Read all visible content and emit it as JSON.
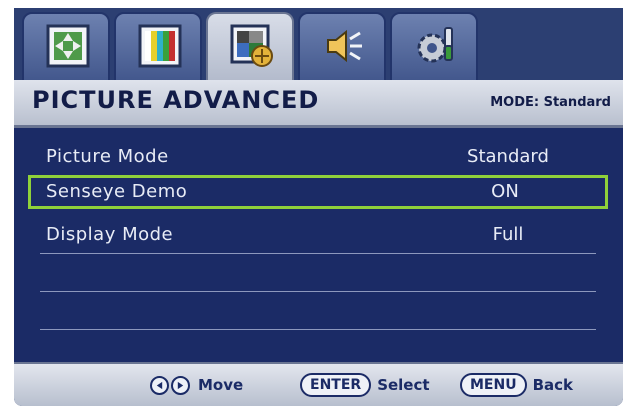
{
  "tabs": [
    {
      "icon": "picture-adjust-icon",
      "active": false
    },
    {
      "icon": "color-bars-icon",
      "active": false
    },
    {
      "icon": "picture-advanced-icon",
      "active": true
    },
    {
      "icon": "speaker-icon",
      "active": false
    },
    {
      "icon": "system-settings-icon",
      "active": false
    }
  ],
  "header": {
    "title": "PICTURE ADVANCED",
    "mode": "MODE: Standard"
  },
  "rows": [
    {
      "label": "Picture Mode",
      "value": "Standard",
      "selected": false
    },
    {
      "label": "Senseye Demo",
      "value": "ON",
      "selected": true
    },
    {
      "label": "Display Mode",
      "value": "Full",
      "selected": false
    },
    {
      "label": "",
      "value": "",
      "selected": false
    },
    {
      "label": "",
      "value": "",
      "selected": false
    }
  ],
  "footer": {
    "move": "Move",
    "enter_key": "ENTER",
    "select": "Select",
    "menu_key": "MENU",
    "back": "Back"
  },
  "colors": {
    "panel": "#1b2b66",
    "selection": "#8fd13a",
    "text": "#e8ecf6"
  }
}
